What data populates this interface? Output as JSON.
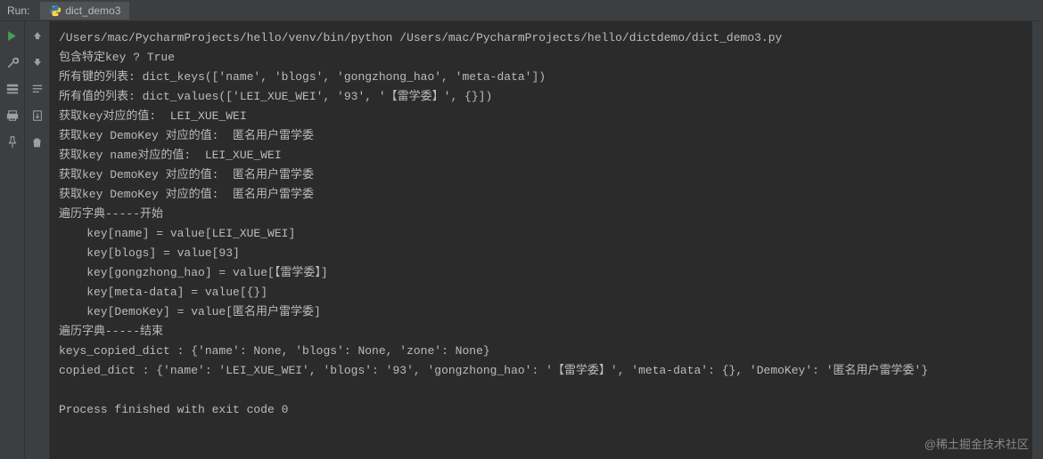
{
  "header": {
    "run_label": "Run:",
    "tab_name": "dict_demo3"
  },
  "toolbar": {
    "icons": [
      "play",
      "settings",
      "layout",
      "print",
      "pin"
    ],
    "side_icons": [
      "up",
      "down",
      "clear",
      "pin",
      "delete"
    ]
  },
  "console_lines": [
    "/Users/mac/PycharmProjects/hello/venv/bin/python /Users/mac/PycharmProjects/hello/dictdemo/dict_demo3.py",
    "包含特定key ? True",
    "所有键的列表: dict_keys(['name', 'blogs', 'gongzhong_hao', 'meta-data'])",
    "所有值的列表: dict_values(['LEI_XUE_WEI', '93', '【雷学委】', {}])",
    "获取key对应的值:  LEI_XUE_WEI",
    "获取key DemoKey 对应的值:  匿名用户雷学委",
    "获取key name对应的值:  LEI_XUE_WEI",
    "获取key DemoKey 对应的值:  匿名用户雷学委",
    "获取key DemoKey 对应的值:  匿名用户雷学委",
    "遍历字典-----开始",
    "    key[name] = value[LEI_XUE_WEI]",
    "    key[blogs] = value[93]",
    "    key[gongzhong_hao] = value[【雷学委】]",
    "    key[meta-data] = value[{}]",
    "    key[DemoKey] = value[匿名用户雷学委]",
    "遍历字典-----结束",
    "keys_copied_dict : {'name': None, 'blogs': None, 'zone': None}",
    "copied_dict : {'name': 'LEI_XUE_WEI', 'blogs': '93', 'gongzhong_hao': '【雷学委】', 'meta-data': {}, 'DemoKey': '匿名用户雷学委'}",
    "",
    "Process finished with exit code 0"
  ],
  "watermark": "@稀土掘金技术社区"
}
